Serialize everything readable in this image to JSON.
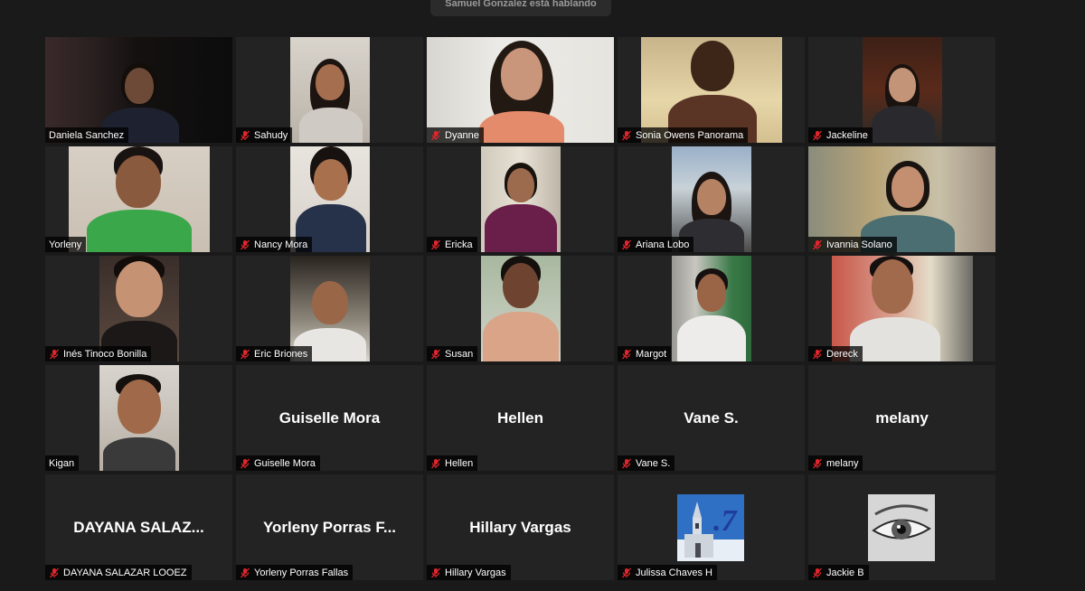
{
  "meeting": {
    "banner_text": "Samuel Gonzalez está hablando"
  },
  "colors": {
    "background": "#1a1a1a",
    "tile": "#232323",
    "muted_icon": "#e0262c",
    "name_text": "#ffffff"
  },
  "participants": [
    {
      "name": "Daniela Sanchez",
      "muted": false,
      "video": true
    },
    {
      "name": "Sahudy",
      "muted": true,
      "video": true
    },
    {
      "name": "Dyanne",
      "muted": true,
      "video": true
    },
    {
      "name": "Sonia Owens Panorama",
      "muted": true,
      "video": true
    },
    {
      "name": "Jackeline",
      "muted": true,
      "video": true
    },
    {
      "name": "Yorleny",
      "muted": false,
      "video": true
    },
    {
      "name": "Nancy Mora",
      "muted": true,
      "video": true
    },
    {
      "name": "Ericka",
      "muted": true,
      "video": true
    },
    {
      "name": "Ariana Lobo",
      "muted": true,
      "video": true
    },
    {
      "name": "Ivannia Solano",
      "muted": true,
      "video": true
    },
    {
      "name": "Inés Tinoco Bonilla",
      "muted": true,
      "video": true
    },
    {
      "name": "Eric Briones",
      "muted": true,
      "video": true
    },
    {
      "name": "Susan",
      "muted": true,
      "video": true
    },
    {
      "name": "Margot",
      "muted": true,
      "video": true
    },
    {
      "name": "Dereck",
      "muted": true,
      "video": true
    },
    {
      "name": "Kigan",
      "muted": false,
      "video": true
    },
    {
      "name": "Guiselle Mora",
      "muted": true,
      "video": false,
      "display_name": "Guiselle Mora"
    },
    {
      "name": "Hellen",
      "muted": true,
      "video": false,
      "display_name": "Hellen"
    },
    {
      "name": "Vane S.",
      "muted": true,
      "video": false,
      "display_name": "Vane S."
    },
    {
      "name": "melany",
      "muted": true,
      "video": false,
      "display_name": "melany"
    },
    {
      "name": "DAYANA SALAZAR LOOEZ",
      "muted": true,
      "video": false,
      "display_name": "DAYANA  SALAZ..."
    },
    {
      "name": "Yorleny Porras Fallas",
      "muted": true,
      "video": false,
      "display_name": "Yorleny Porras F..."
    },
    {
      "name": "Hillary Vargas",
      "muted": true,
      "video": false,
      "display_name": "Hillary Vargas"
    },
    {
      "name": "Julissa Chaves H",
      "muted": true,
      "video": false,
      "picture": "church-7-picture"
    },
    {
      "name": "Jackie B",
      "muted": true,
      "video": false,
      "picture": "eye-picture"
    }
  ]
}
